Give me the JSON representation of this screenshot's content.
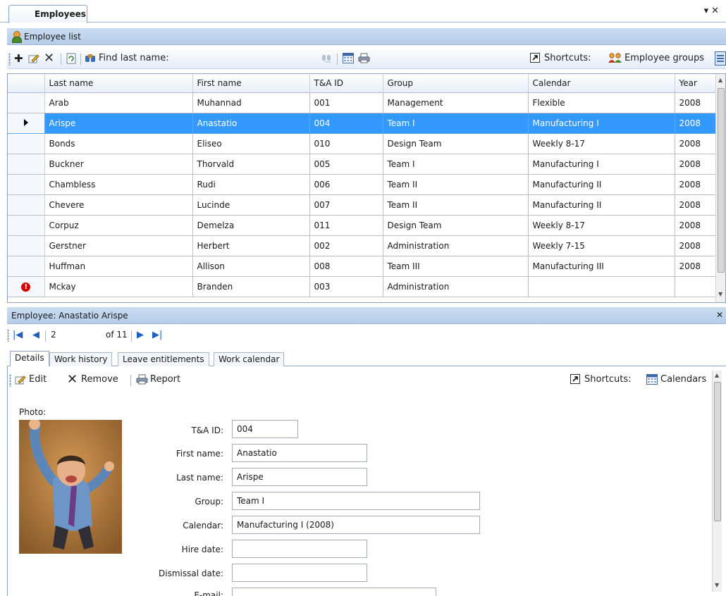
{
  "document_tab": {
    "title": "Employees"
  },
  "list_panel": {
    "header": "Employee list",
    "toolbar": {
      "find_label": "Find last name:",
      "shortcuts_label": "Shortcuts:",
      "employee_groups_label": "Employee groups"
    },
    "columns": [
      "Last name",
      "First name",
      "T&A ID",
      "Group",
      "Calendar",
      "Year"
    ],
    "rows": [
      {
        "last": "Arab",
        "first": "Muhannad",
        "id": "001",
        "group": "Management",
        "calendar": "Flexible",
        "year": "2008"
      },
      {
        "last": "Arispe",
        "first": "Anastatio",
        "id": "004",
        "group": "Team I",
        "calendar": "Manufacturing I",
        "year": "2008",
        "selected": true
      },
      {
        "last": "Bonds",
        "first": "Eliseo",
        "id": "010",
        "group": "Design Team",
        "calendar": "Weekly 8-17",
        "year": "2008"
      },
      {
        "last": "Buckner",
        "first": "Thorvald",
        "id": "005",
        "group": "Team I",
        "calendar": "Manufacturing I",
        "year": "2008"
      },
      {
        "last": "Chambless",
        "first": "Rudi",
        "id": "006",
        "group": "Team II",
        "calendar": "Manufacturing II",
        "year": "2008"
      },
      {
        "last": "Chevere",
        "first": "Lucinde",
        "id": "007",
        "group": "Team II",
        "calendar": "Manufacturing II",
        "year": "2008"
      },
      {
        "last": "Corpuz",
        "first": "Demelza",
        "id": "011",
        "group": "Design Team",
        "calendar": "Weekly 8-17",
        "year": "2008"
      },
      {
        "last": "Gerstner",
        "first": "Herbert",
        "id": "002",
        "group": "Administration",
        "calendar": "Weekly 7-15",
        "year": "2008"
      },
      {
        "last": "Huffman",
        "first": "Allison",
        "id": "008",
        "group": "Team III",
        "calendar": "Manufacturing III",
        "year": "2008"
      },
      {
        "last": "Mckay",
        "first": "Branden",
        "id": "003",
        "group": "Administration",
        "calendar": "",
        "year": "",
        "error": true
      }
    ]
  },
  "detail_panel": {
    "header": "Employee: Anastatio Arispe",
    "navigator": {
      "current": "2",
      "of_label": "of 11"
    },
    "tabs": [
      "Details",
      "Work history",
      "Leave entitlements",
      "Work calendar"
    ],
    "toolbar": {
      "edit_label": "Edit",
      "remove_label": "Remove",
      "report_label": "Report",
      "shortcuts_label": "Shortcuts:",
      "calendars_label": "Calendars"
    },
    "photo_label": "Photo:",
    "fields": {
      "ta_id": {
        "label": "T&A ID:",
        "value": "004"
      },
      "first_name": {
        "label": "First name:",
        "value": "Anastatio"
      },
      "last_name": {
        "label": "Last name:",
        "value": "Arispe"
      },
      "group": {
        "label": "Group:",
        "value": "Team I"
      },
      "calendar": {
        "label": "Calendar:",
        "value": "Manufacturing I  (2008)"
      },
      "hire_date": {
        "label": "Hire date:",
        "value": ""
      },
      "dismissal_date": {
        "label": "Dismissal date:",
        "value": ""
      },
      "email": {
        "label": "E-mail:",
        "value": ""
      }
    }
  },
  "colors": {
    "selection": "#3399ff",
    "section_bar": "#c9dcf1",
    "error": "#d80000"
  }
}
